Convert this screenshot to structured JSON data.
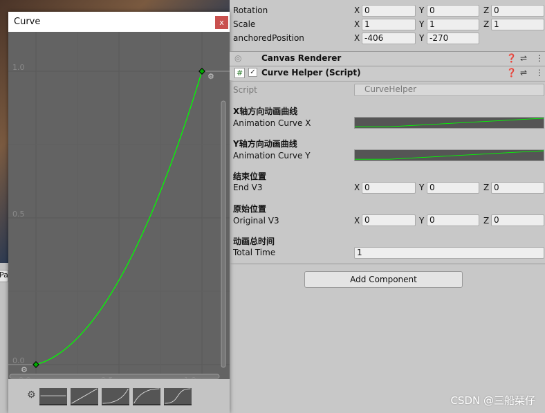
{
  "curve_window": {
    "title": "Curve",
    "close": "x",
    "y_labels": [
      "1.0",
      "0.5",
      "0.0"
    ],
    "x_labels": [
      "0.0",
      "0.5",
      "1.0"
    ],
    "curve_color": "#00ff00",
    "keys": [
      [
        0,
        0
      ],
      [
        1,
        1
      ]
    ]
  },
  "background": {
    "partial_label": "Pa"
  },
  "inspector": {
    "rotation": {
      "label": "Rotation",
      "x": "0",
      "y": "0",
      "z": "0"
    },
    "scale": {
      "label": "Scale",
      "x": "1",
      "y": "1",
      "z": "1"
    },
    "anchored": {
      "label": "anchoredPosition",
      "x": "-406",
      "y": "-270"
    },
    "canvas_renderer": "Canvas Renderer",
    "curve_helper": "Curve Helper (Script)",
    "script_label": "Script",
    "script_value": "CurveHelper",
    "curve_x_header": "X轴方向动画曲线",
    "curve_x_label": "Animation Curve X",
    "curve_y_header": "Y轴方向动画曲线",
    "curve_y_label": "Animation Curve Y",
    "end_header": "结束位置",
    "end_label": "End V3",
    "end": {
      "x": "0",
      "y": "0",
      "z": "0"
    },
    "orig_header": "原始位置",
    "orig_label": "Original V3",
    "orig": {
      "x": "0",
      "y": "0",
      "z": "0"
    },
    "time_header": "动画总时间",
    "time_label": "Total Time",
    "time": "1",
    "add_component": "Add Component",
    "axes": {
      "x": "X",
      "y": "Y",
      "z": "Z"
    }
  },
  "watermark": "CSDN @三船栞仔"
}
